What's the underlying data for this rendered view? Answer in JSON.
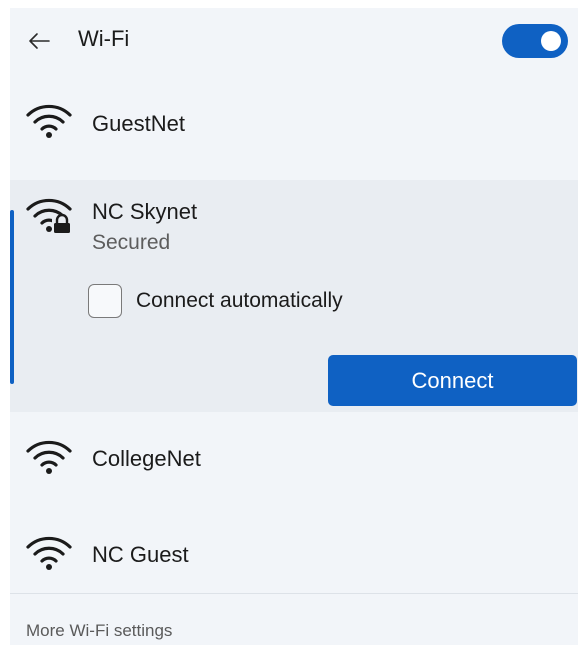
{
  "header": {
    "title": "Wi-Fi",
    "back_icon": "arrow-left-icon",
    "wifi_toggle_on": true,
    "accent_color": "#0f61c3"
  },
  "networks": [
    {
      "name": "GuestNet",
      "icon": "wifi-signal-icon",
      "selected": false
    },
    {
      "name": "NC Skynet",
      "icon": "wifi-secured-icon",
      "selected": true,
      "status": "Secured",
      "connect_automatically_label": "Connect automatically",
      "connect_automatically_checked": false,
      "connect_label": "Connect"
    },
    {
      "name": "CollegeNet",
      "icon": "wifi-signal-icon",
      "selected": false
    },
    {
      "name": "NC Guest",
      "icon": "wifi-signal-icon",
      "selected": false
    }
  ],
  "footer": {
    "more_settings_label": "More Wi-Fi settings"
  }
}
